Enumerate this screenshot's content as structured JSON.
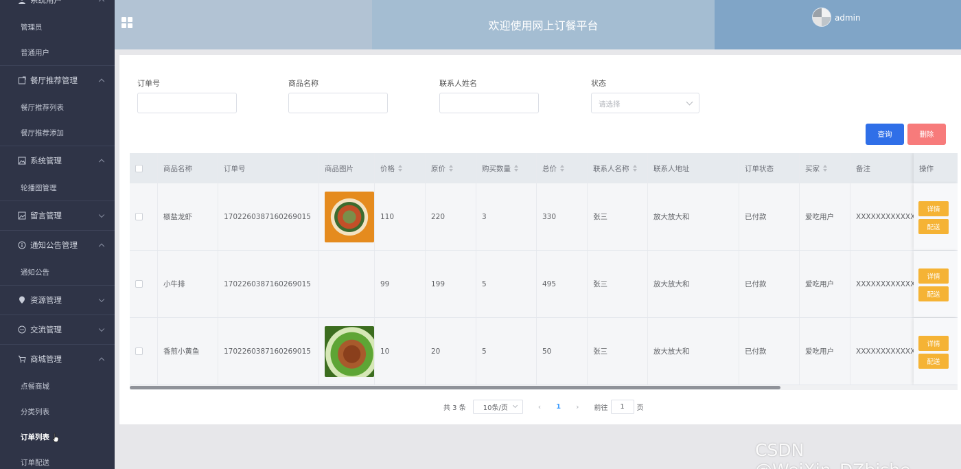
{
  "sidebar": {
    "groups": [
      {
        "label": "系统用户",
        "icon": "user-icon",
        "expanded": true,
        "items": [
          "管理员",
          "普通用户"
        ]
      },
      {
        "label": "餐厅推荐管理",
        "icon": "restaurant-icon",
        "expanded": true,
        "items": [
          "餐厅推荐列表",
          "餐厅推荐添加"
        ]
      },
      {
        "label": "系统管理",
        "icon": "image-icon",
        "expanded": true,
        "items": [
          "轮播图管理"
        ]
      },
      {
        "label": "留言管理",
        "icon": "message-icon",
        "expanded": false,
        "items": []
      },
      {
        "label": "通知公告管理",
        "icon": "info-icon",
        "expanded": true,
        "items": [
          "通知公告"
        ]
      },
      {
        "label": "资源管理",
        "icon": "location-icon",
        "expanded": false,
        "items": []
      },
      {
        "label": "交流管理",
        "icon": "chat-icon",
        "expanded": false,
        "items": []
      },
      {
        "label": "商城管理",
        "icon": "cart-icon",
        "expanded": true,
        "items": [
          "点餐商城",
          "分类列表",
          "订单列表",
          "订单配送"
        ]
      }
    ],
    "active_item": "订单列表"
  },
  "header": {
    "title": "欢迎使用网上订餐平台",
    "user": "admin"
  },
  "search": {
    "order_no_label": "订单号",
    "product_name_label": "商品名称",
    "contact_name_label": "联系人姓名",
    "status_label": "状态",
    "status_placeholder": "请选择",
    "query_button": "查询",
    "delete_button": "删除"
  },
  "table": {
    "headers": {
      "product_name": "商品名称",
      "order_no": "订单号",
      "product_image": "商品图片",
      "price": "价格",
      "original_price": "原价",
      "quantity": "购买数量",
      "total": "总价",
      "contact_name": "联系人名称",
      "contact_address": "联系人地址",
      "order_status": "订单状态",
      "buyer": "买家",
      "remark": "备注",
      "actions": "操作"
    },
    "rows": [
      {
        "product_name": "椒盐龙虾",
        "order_no": "1702260387160269015",
        "image": "shrimp",
        "price": "110",
        "original_price": "220",
        "quantity": "3",
        "total": "330",
        "contact_name": "张三",
        "contact_address": "放大放大和",
        "order_status": "已付款",
        "buyer": "爱吃用户",
        "remark": "XXXXXXXXXXXXX"
      },
      {
        "product_name": "小牛排",
        "order_no": "1702260387160269015",
        "image": "",
        "price": "99",
        "original_price": "199",
        "quantity": "5",
        "total": "495",
        "contact_name": "张三",
        "contact_address": "放大放大和",
        "order_status": "已付款",
        "buyer": "爱吃用户",
        "remark": "XXXXXXXXXXXXX"
      },
      {
        "product_name": "香煎小黄鱼",
        "order_no": "1702260387160269015",
        "image": "fish",
        "price": "10",
        "original_price": "20",
        "quantity": "5",
        "total": "50",
        "contact_name": "张三",
        "contact_address": "放大放大和",
        "order_status": "已付款",
        "buyer": "爱吃用户",
        "remark": "XXXXXXXXXXXXX"
      }
    ],
    "detail_button": "详情",
    "deliver_button": "配送"
  },
  "pagination": {
    "total_text": "共 3 条",
    "page_size": "10条/页",
    "current_page": "1",
    "goto_label": "前往",
    "goto_value": "1",
    "page_suffix": "页"
  },
  "watermark": "CSDN @WeiXin_DZbishe"
}
